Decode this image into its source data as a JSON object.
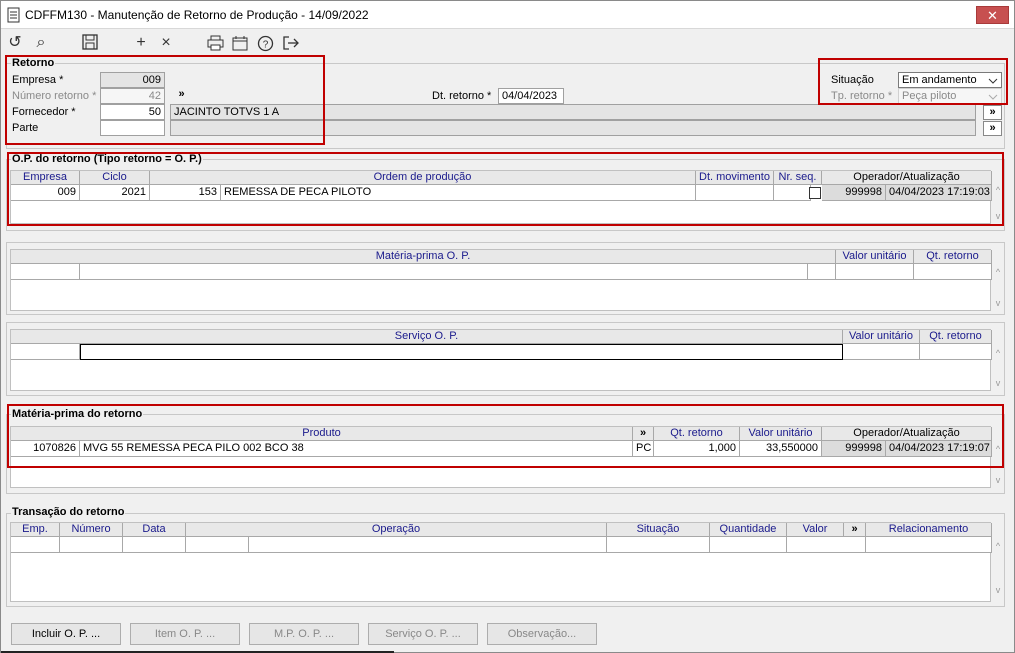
{
  "window": {
    "title": "CDFFM130 - Manutenção de Retorno de Produção - 14/09/2022",
    "close_label": "✕"
  },
  "toolbar": {
    "undo": "↺",
    "search": "⌕",
    "save": "💾",
    "add": "+",
    "delete": "×",
    "print": "🖶",
    "calendar": "📅",
    "help": "?",
    "exit": "⇥"
  },
  "retorno": {
    "title": "Retorno",
    "empresa_label": "Empresa *",
    "empresa_value": "009",
    "numero_label": "Número retorno *",
    "numero_value": "42",
    "fornecedor_label": "Fornecedor *",
    "fornecedor_value": "50",
    "fornecedor_nome": "JACINTO TOTVS 1 A",
    "parte_label": "Parte",
    "parte_value": "",
    "dt_label": "Dt. retorno *",
    "dt_value": "04/04/2023",
    "situacao_label": "Situação",
    "situacao_value": "Em andamento",
    "tp_label": "Tp. retorno *",
    "tp_value": "Peça piloto",
    "more": "»"
  },
  "op": {
    "title": "O.P. do retorno (Tipo retorno = O. P.)",
    "headers": [
      "Empresa",
      "Ciclo",
      "Ordem de produção",
      "Dt. movimento",
      "Nr. seq.",
      "Operador/Atualização"
    ],
    "row": {
      "empresa": "009",
      "ciclo": "2021",
      "ordem_num": "153",
      "ordem_desc": "REMESSA DE PECA PILOTO",
      "dt": "",
      "seq": "",
      "operador": "999998",
      "atualizacao": "04/04/2023 17:19:03"
    }
  },
  "mp_op": {
    "headers": [
      "Matéria-prima O. P.",
      "Valor unitário",
      "Qt. retorno"
    ]
  },
  "serv_op": {
    "headers": [
      "Serviço O. P.",
      "Valor unitário",
      "Qt. retorno"
    ]
  },
  "mp_ret": {
    "title": "Matéria-prima do retorno",
    "headers": [
      "Produto",
      "»",
      "Qt. retorno",
      "Valor unitário",
      "Operador/Atualização"
    ],
    "row": {
      "codigo": "1070826",
      "descricao": "MVG 55 REMESSA PECA PILO 002 BCO 38",
      "un": "PC",
      "qt": "1,000",
      "valor": "33,550000",
      "operador": "999998",
      "atualizacao": "04/04/2023 17:19:07"
    }
  },
  "transacao": {
    "title": "Transação do retorno",
    "headers": [
      "Emp.",
      "Número",
      "Data",
      "Operação",
      "Situação",
      "Quantidade",
      "Valor",
      "»",
      "Relacionamento"
    ]
  },
  "buttons": {
    "incluir": "Incluir O. P. ...",
    "item": "Item O. P. ...",
    "mp": "M.P. O. P. ...",
    "servico": "Serviço O. P. ...",
    "obs": "Observação..."
  },
  "scroll": {
    "up": "^",
    "down": "v"
  }
}
